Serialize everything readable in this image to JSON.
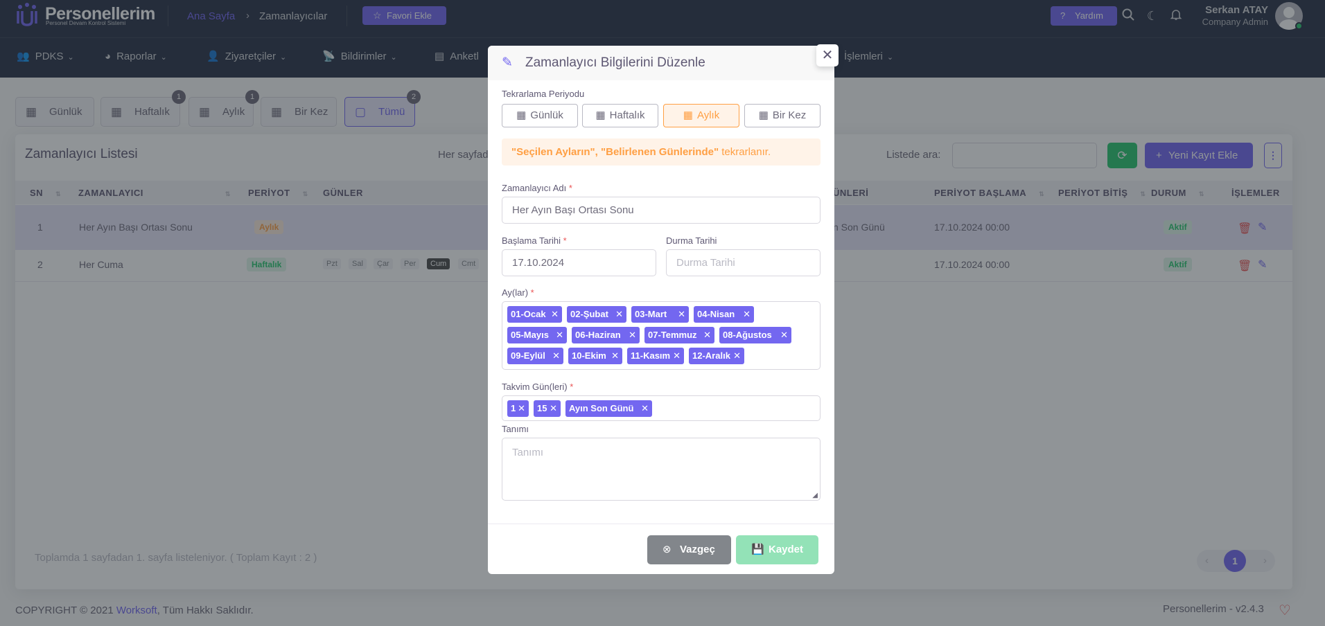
{
  "topbar": {
    "logo_name": "Personellerim",
    "logo_sub": "Personel Devam Kontrol Sistemi",
    "breadcrumb_home": "Ana Sayfa",
    "breadcrumb_current": "Zamanlayıcılar",
    "favorite_label": "Favori Ekle",
    "help_label": "Yardım",
    "user_name": "Serkan ATAY",
    "user_role": "Company Admin"
  },
  "menu": [
    {
      "label": "PDKS",
      "icon": "users-icon"
    },
    {
      "label": "Raporlar",
      "icon": "pie-chart-icon"
    },
    {
      "label": "Ziyaretçiler",
      "icon": "user-plus-icon"
    },
    {
      "label": "Bildirimler",
      "icon": "broadcast-icon"
    },
    {
      "label": "Anketl",
      "icon": "document-icon"
    },
    {
      "label": "İşlemleri",
      "icon": ""
    }
  ],
  "tabs": [
    {
      "label": "Günlük",
      "badge": ""
    },
    {
      "label": "Haftalık",
      "badge": "1"
    },
    {
      "label": "Aylık",
      "badge": "1"
    },
    {
      "label": "Bir Kez",
      "badge": ""
    },
    {
      "label": "Tümü",
      "badge": "2"
    }
  ],
  "list": {
    "title": "Zamanlayıcı Listesi",
    "per_page_text": "Her sayfad",
    "search_label": "Listede ara:",
    "new_label": "Yeni Kayıt Ekle",
    "columns": [
      "SN",
      "ZAMANLAYICI",
      "PERİYOT",
      "GÜNLER",
      "ÜNLERİ",
      "PERİYOT BAŞLAMA",
      "PERİYOT BİTİŞ",
      "DURUM",
      "İŞLEMLER"
    ],
    "rows": [
      {
        "sn": "1",
        "name": "Her Ayın Başı Ortası Sonu",
        "period": "Aylık",
        "days_text": "n Son Günü",
        "start": "17.10.2024 00:00",
        "status": "Aktif"
      },
      {
        "sn": "2",
        "name": "Her Cuma",
        "period": "Haftalık",
        "days": [
          "Pzt",
          "Sal",
          "Çar",
          "Per",
          "Cum",
          "Cmt"
        ],
        "active_day": "Cum",
        "start": "17.10.2024 00:00",
        "status": "Aktif"
      }
    ],
    "footer_info": "Toplamda 1 sayfadan 1. sayfa listeleniyor. ( Toplam Kayıt : 2 )",
    "current_page": "1"
  },
  "footer": {
    "copyright_prefix": "COPYRIGHT © 2021 ",
    "copyright_link": "Worksoft",
    "copyright_suffix": ", Tüm Hakkı Saklıdır.",
    "version": "Personellerim - v2.4.3"
  },
  "modal": {
    "title": "Zamanlayıcı Bilgilerini Düzenle",
    "period_label": "Tekrarlama Periyodu",
    "periods": [
      "Günlük",
      "Haftalık",
      "Aylık",
      "Bir Kez"
    ],
    "selected_period": "Aylık",
    "alert_bold": "\"Seçilen Ayların\", \"Belirlenen Günlerinde\"",
    "alert_rest": " tekrarlanır.",
    "name_label": "Zamanlayıcı Adı",
    "name_value": "Her Ayın Başı Ortası Sonu",
    "start_label": "Başlama Tarihi",
    "start_value": "17.10.2024",
    "stop_label": "Durma Tarihi",
    "stop_placeholder": "Durma Tarihi",
    "months_label": "Ay(lar)",
    "months": [
      "01-Ocak",
      "02-Şubat",
      "03-Mart",
      "04-Nisan",
      "05-Mayıs",
      "06-Haziran",
      "07-Temmuz",
      "08-Ağustos",
      "09-Eylül",
      "10-Ekim",
      "11-Kasım",
      "12-Aralık"
    ],
    "days_label": "Takvim Gün(leri)",
    "days": [
      "1",
      "15",
      "Ayın Son Günü"
    ],
    "desc_label": "Tanımı",
    "desc_placeholder": "Tanımı",
    "cancel_label": "Vazgeç",
    "save_label": "Kaydet"
  },
  "colors": {
    "primary": "#7367f0",
    "success": "#28c76f",
    "warning": "#ff9f43",
    "danger": "#ea5455",
    "navbar": "#283046"
  }
}
